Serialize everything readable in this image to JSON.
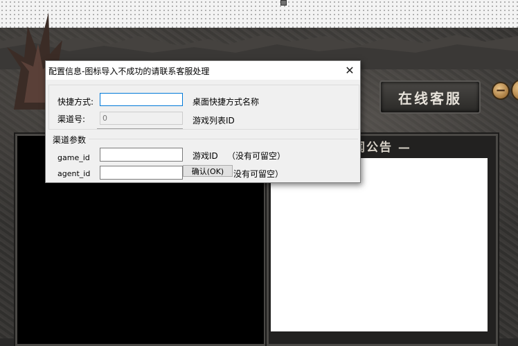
{
  "background": {
    "service_button": "在线客服",
    "news_title": "闻公告 —"
  },
  "dialog": {
    "title": "配置信息-图标导入不成功的请联系客服处理",
    "close_icon": "close-icon",
    "shortcut": {
      "label": "快捷方式:",
      "value": "",
      "hint": "桌面快捷方式名称"
    },
    "channel": {
      "label": "渠道号:",
      "placeholder": "0",
      "hint": "游戏列表ID"
    },
    "params_group": "渠道参数",
    "game_id": {
      "label": "game_id",
      "value": "",
      "hint": "游戏ID",
      "note": "（没有可留空）"
    },
    "agent_id": {
      "label": "agent_id",
      "value": "",
      "note": "没有可留空）"
    },
    "ok_button": "确认(OK)"
  }
}
